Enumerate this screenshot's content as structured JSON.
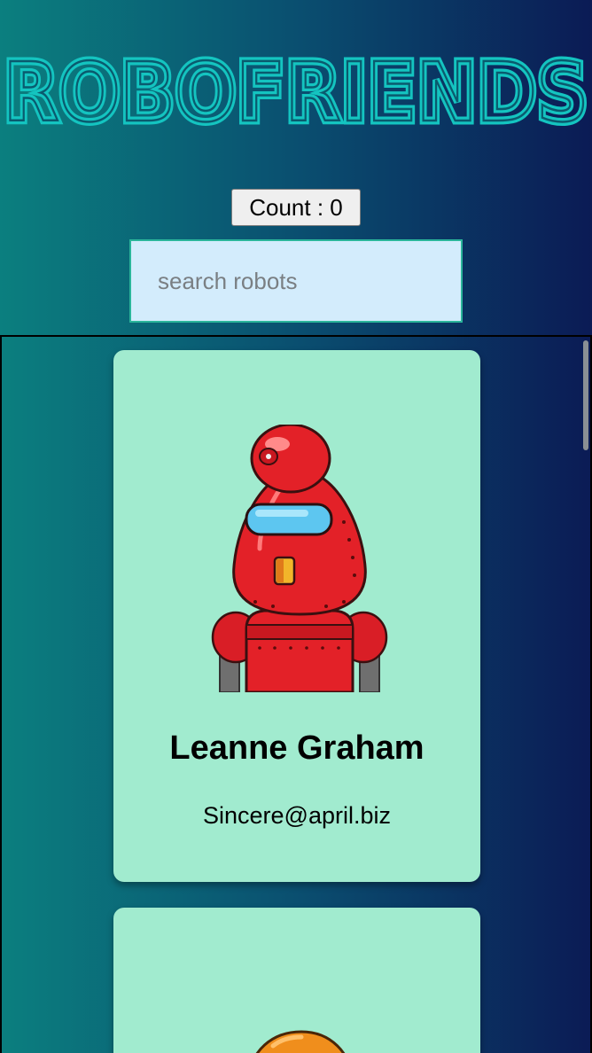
{
  "header": {
    "title": "ROBOFRIENDS",
    "title_color": "#14c4c0"
  },
  "counter": {
    "label": "Count : 0"
  },
  "search": {
    "placeholder": "search robots",
    "value": ""
  },
  "cards": [
    {
      "name": "Leanne Graham",
      "email": "Sincere@april.biz",
      "image": "red-robot-avatar"
    },
    {
      "name": "",
      "email": "",
      "image": "orange-robot-avatar"
    }
  ],
  "colors": {
    "card_background": "#a1ebcf",
    "search_background": "#d3ecfc",
    "search_border": "#2bb59a",
    "gradient_left": "#0b7f7f",
    "gradient_right": "#0b1b55"
  }
}
